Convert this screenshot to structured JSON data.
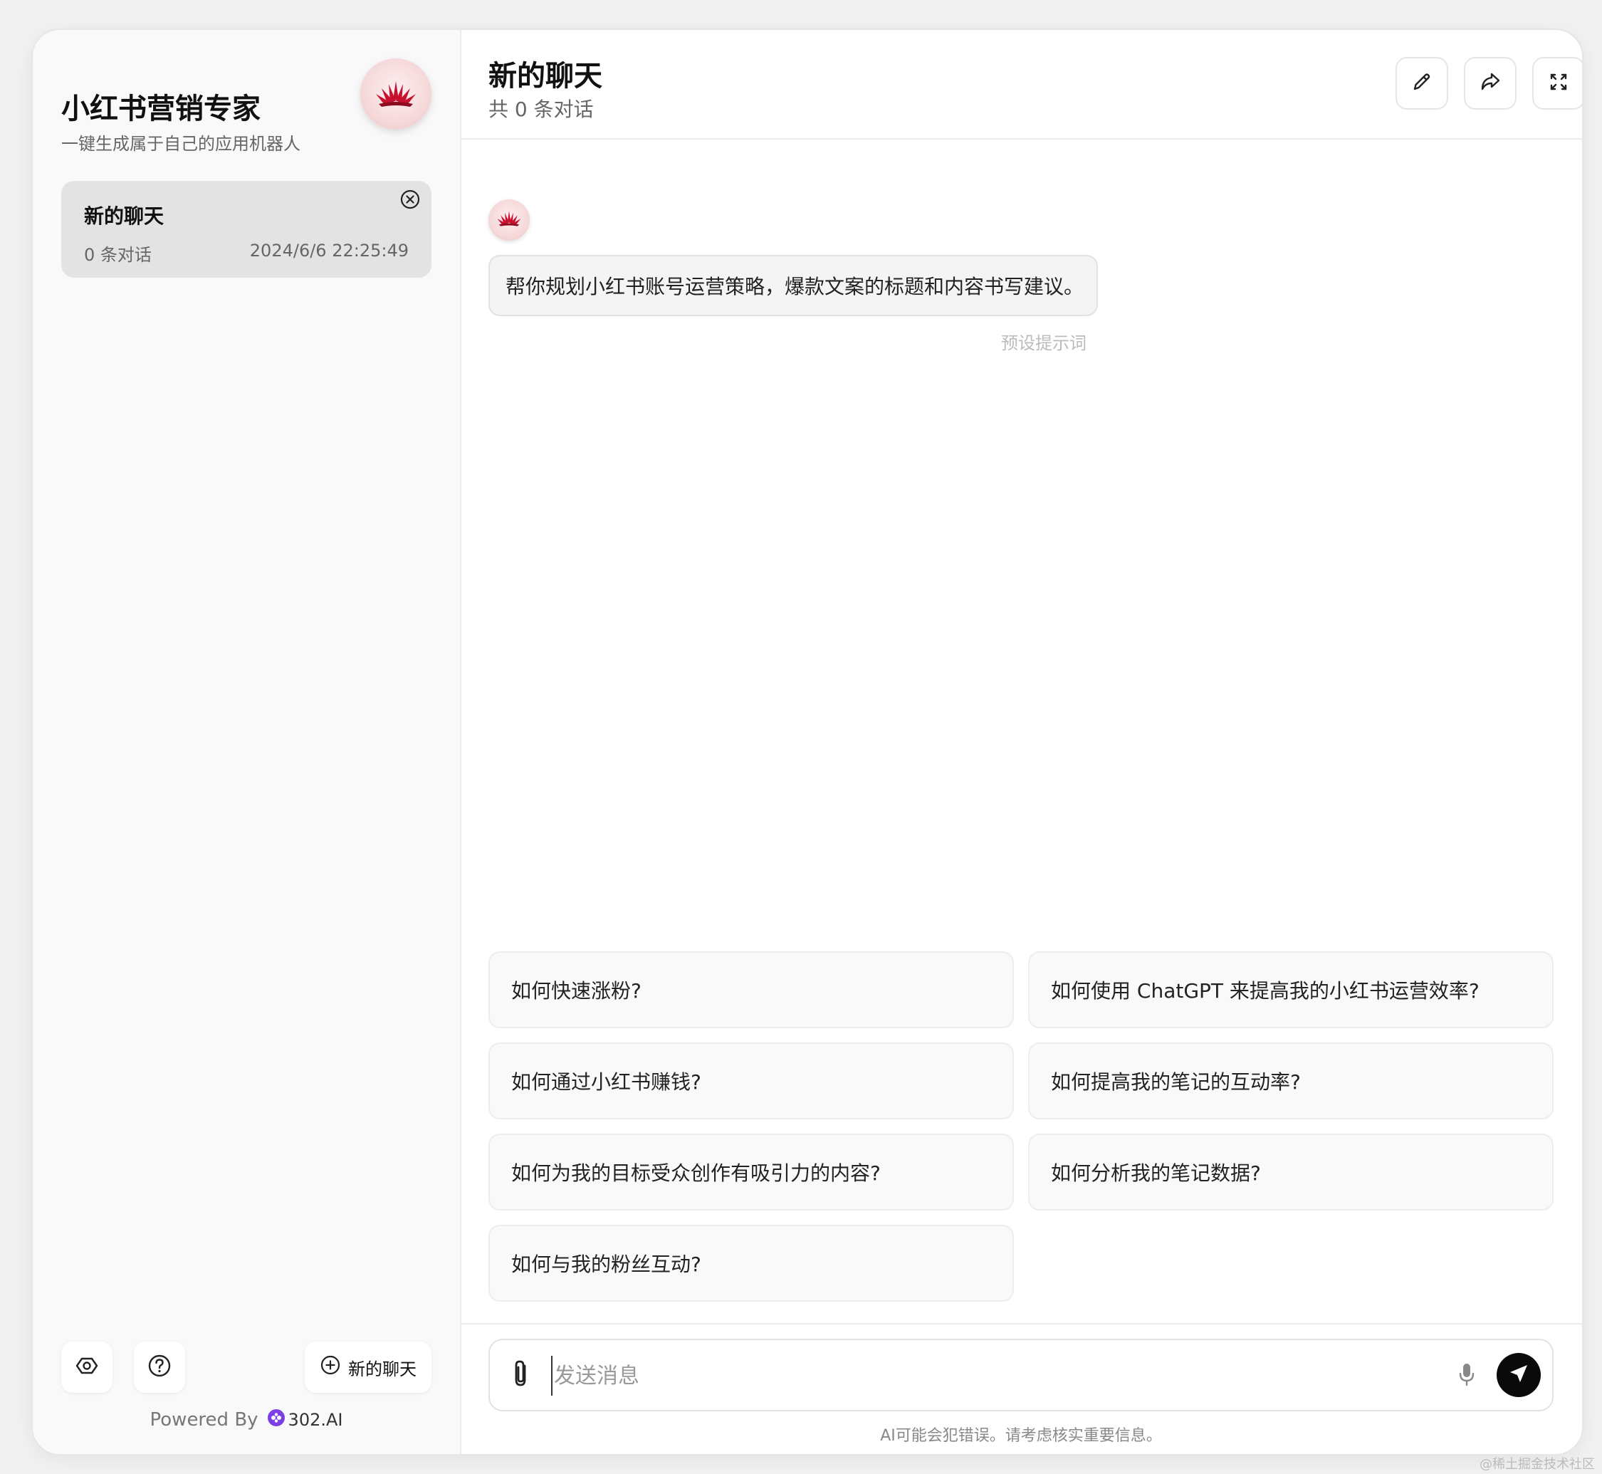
{
  "sidebar": {
    "app_title": "小红书营销专家",
    "app_subtitle": "一键生成属于自己的应用机器人",
    "logo_icon": "lotus-logo-icon",
    "chats": [
      {
        "title": "新的聊天",
        "count": "0 条对话",
        "time": "2024/6/6 22:25:49"
      }
    ],
    "settings_icon": "settings-hex-icon",
    "help_icon": "help-circle-icon",
    "new_chat_label": "新的聊天",
    "powered_by": "Powered By",
    "brand_name": "302.AI"
  },
  "header": {
    "title": "新的聊天",
    "subtitle": "共 0 条对话",
    "edit_icon": "pencil-icon",
    "share_icon": "share-icon",
    "fullscreen_icon": "fullscreen-icon"
  },
  "messages": {
    "preset_text": "帮你规划小红书账号运营策略，爆款文案的标题和内容书写建议。",
    "preset_label": "预设提示词"
  },
  "suggestions": [
    "如何快速涨粉?",
    "如何使用 ChatGPT 来提高我的小红书运营效率?",
    "如何通过小红书赚钱?",
    "如何提高我的笔记的互动率?",
    "如何为我的目标受众创作有吸引力的内容?",
    "如何分析我的笔记数据?",
    "如何与我的粉丝互动?"
  ],
  "input": {
    "placeholder": "发送消息",
    "value": ""
  },
  "disclaimer": "AI可能会犯错误。请考虑核实重要信息。",
  "watermark": "@稀土掘金技术社区",
  "colors": {
    "accent": "#0a0a0a",
    "logo_red": "#c8102e",
    "brand_purple": "#7b3fe4"
  }
}
